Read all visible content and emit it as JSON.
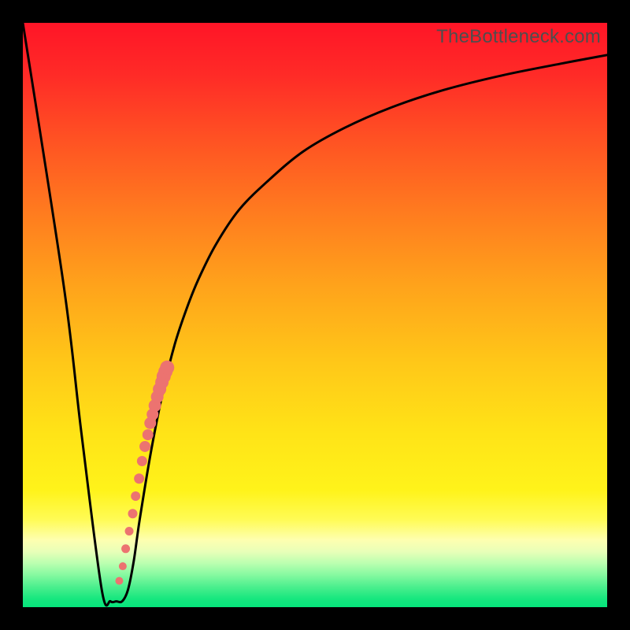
{
  "watermark": "TheBottleneck.com",
  "colors": {
    "frame": "#000000",
    "curve": "#000000",
    "dots": "#ec7370",
    "gradient_top": "#ff1527",
    "gradient_mid": "#ffd21a",
    "gradient_bottom": "#06e57c"
  },
  "chart_data": {
    "type": "line",
    "title": "",
    "xlabel": "",
    "ylabel": "",
    "xlim": [
      0,
      100
    ],
    "ylim": [
      0,
      100
    ],
    "series": [
      {
        "name": "bottleneck-curve",
        "x": [
          0,
          7,
          10,
          13.5,
          15,
          16,
          17,
          18,
          19,
          20,
          22,
          24,
          26,
          28,
          30,
          33,
          37,
          42,
          48,
          55,
          63,
          72,
          82,
          92,
          100
        ],
        "y": [
          100,
          55,
          30,
          3,
          1,
          1,
          1,
          3,
          8,
          15,
          27,
          37,
          45,
          51,
          56,
          62,
          68,
          73,
          78,
          82,
          85.5,
          88.5,
          91,
          93,
          94.5
        ]
      }
    ],
    "scatter": {
      "name": "gpu-points",
      "x": [
        16.5,
        17.1,
        17.6,
        18.2,
        18.8,
        19.3,
        19.9,
        20.4,
        20.9,
        21.4,
        21.8,
        22.2,
        22.6,
        23.0,
        23.4,
        23.8,
        24.1,
        24.4,
        24.7
      ],
      "y": [
        4.5,
        7.0,
        10.0,
        13.0,
        16.0,
        19.0,
        22.0,
        25.0,
        27.5,
        29.5,
        31.5,
        33.0,
        34.5,
        36.0,
        37.3,
        38.5,
        39.5,
        40.3,
        41.0
      ],
      "r": [
        5,
        5,
        5.5,
        5.5,
        6,
        6,
        6.5,
        6.5,
        7,
        7,
        7.5,
        7.5,
        8,
        8,
        8.5,
        8.5,
        9,
        9,
        9
      ]
    }
  }
}
